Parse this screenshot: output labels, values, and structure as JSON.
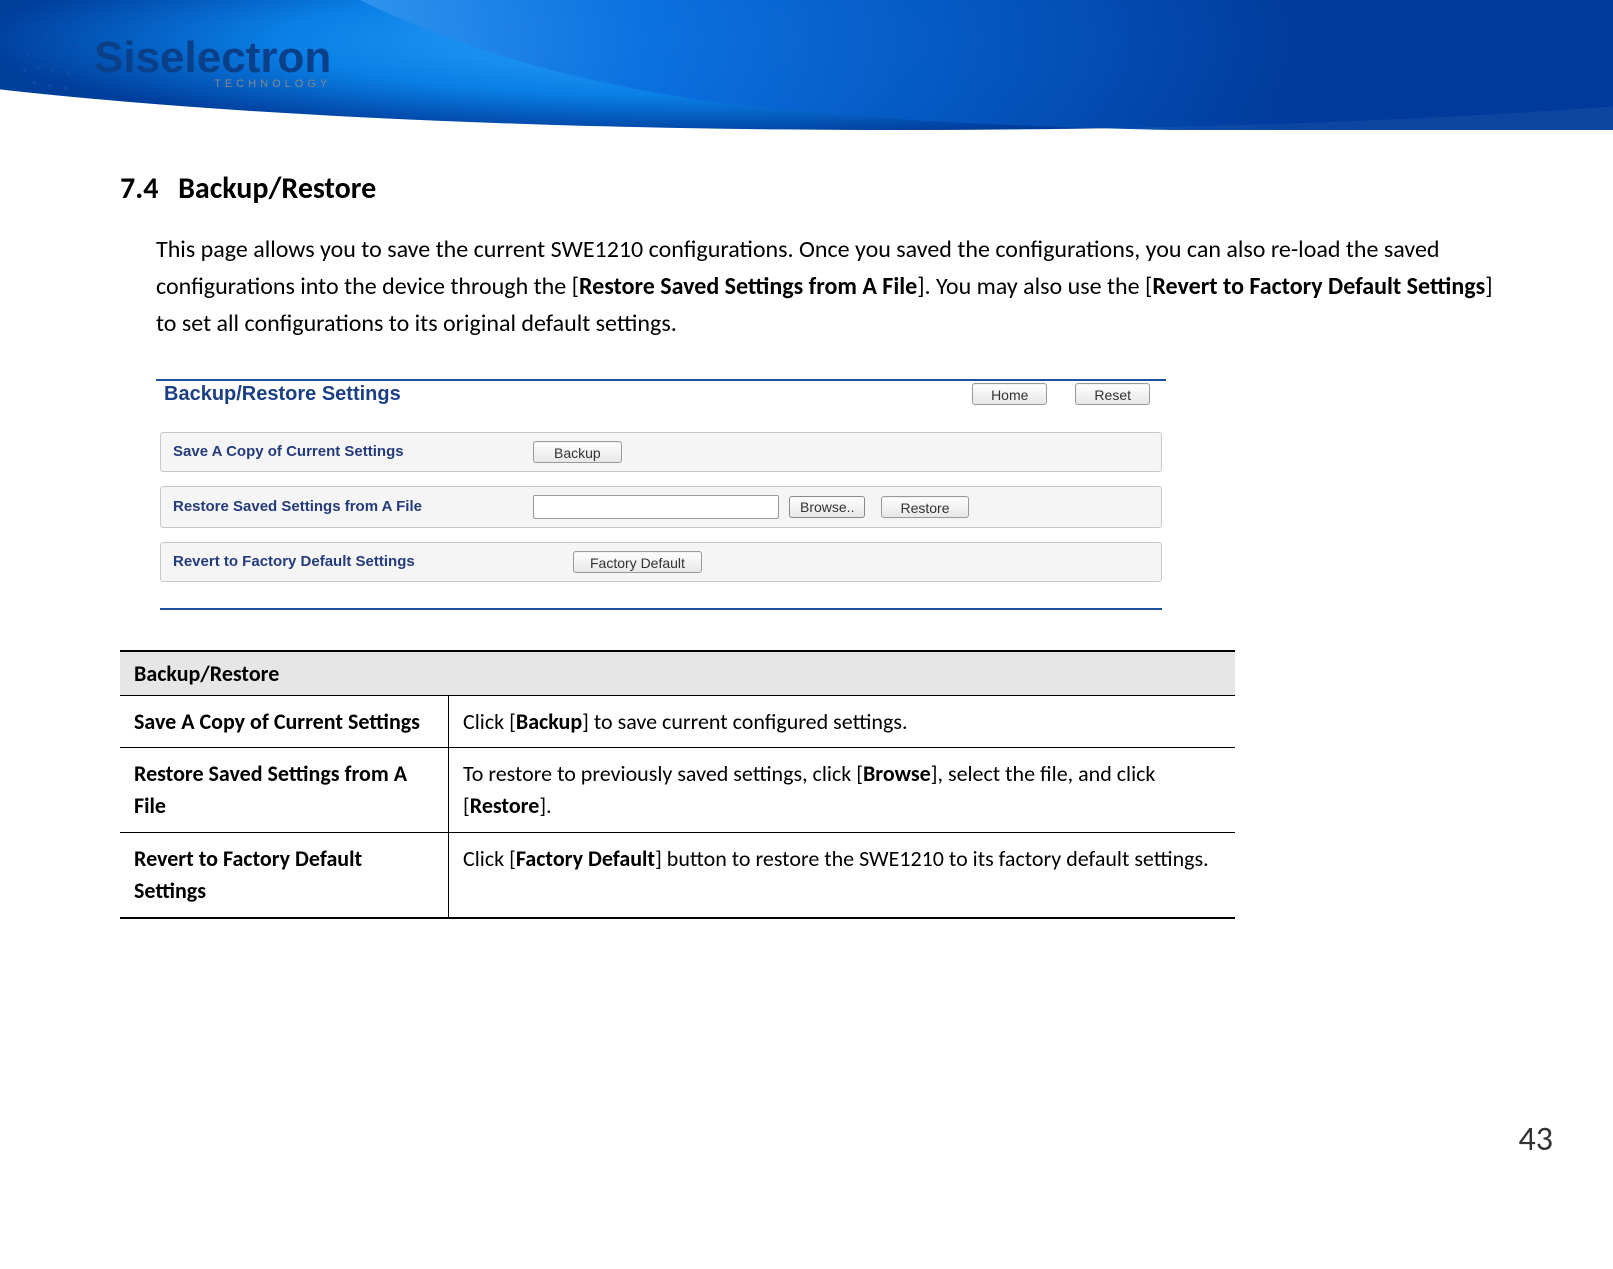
{
  "banner": {
    "brand": "Siselectron",
    "brand_sub": "TECHNOLOGY"
  },
  "section": {
    "number": "7.4",
    "title": "Backup/Restore",
    "intro_pre": "This page allows you to save the current SWE1210 configurations. Once you saved the configurations, you can also re-load the saved configurations into the device through the [",
    "intro_bold1": "Restore Saved Settings from A File",
    "intro_mid": "]. You may also use the [",
    "intro_bold2": "Revert to Factory Default Settings",
    "intro_post": "] to set all configurations to its original default settings."
  },
  "ui": {
    "panel_title": "Backup/Restore Settings",
    "btn_home": "Home",
    "btn_reset": "Reset",
    "row1_label": "Save A Copy of Current Settings",
    "btn_backup": "Backup",
    "row2_label": "Restore Saved Settings from A File",
    "file_value": "",
    "btn_browse": "Browse..",
    "btn_restore": "Restore",
    "row3_label": "Revert to Factory Default Settings",
    "btn_factory": "Factory Default"
  },
  "table": {
    "header": "Backup/Restore",
    "rows": [
      {
        "label": "Save A Copy of Current Settings",
        "pre": "Click [",
        "b1": "Backup",
        "post": "] to save current configured settings."
      },
      {
        "label": "Restore Saved Settings from A File",
        "pre": "To restore to previously saved settings, click [",
        "b1": "Browse",
        "mid": "], select the file, and click [",
        "b2": "Restore",
        "post": "]."
      },
      {
        "label": "Revert to Factory Default Settings",
        "pre": "Click [",
        "b1": "Factory Default",
        "post": "] button to restore the SWE1210 to its factory default settings."
      }
    ]
  },
  "page_number": "43"
}
